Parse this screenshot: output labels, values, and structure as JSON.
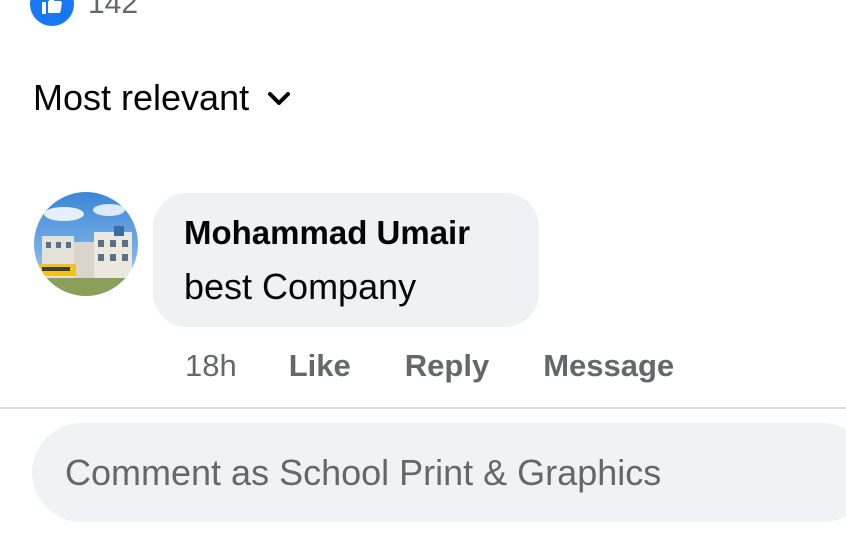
{
  "reactions": {
    "count": "142",
    "icon": "like-icon",
    "badge_color": "#1877f2"
  },
  "sort": {
    "label": "Most relevant",
    "icon": "chevron-down-icon"
  },
  "comment": {
    "author": "Mohammad Umair",
    "text": "best Company",
    "time": "18h",
    "actions": [
      "Like",
      "Reply",
      "Message"
    ]
  },
  "composer": {
    "placeholder": "Comment as School Print & Graphics"
  },
  "colors": {
    "secondary_text": "#65676b",
    "bubble": "#eff1f5",
    "accent": "#1877f2"
  }
}
